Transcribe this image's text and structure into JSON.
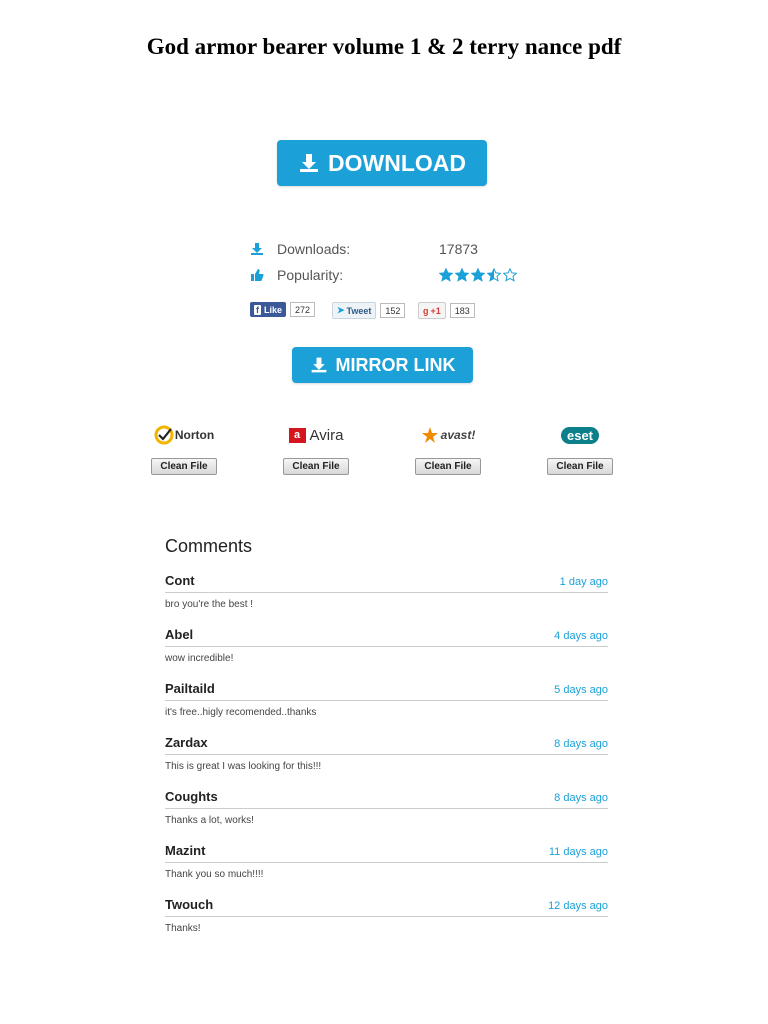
{
  "title": "God armor bearer volume 1 & 2 terry nance pdf",
  "download_button": {
    "label": "DOWNLOAD"
  },
  "stats": {
    "downloads_label": "Downloads:",
    "downloads_value": "17873",
    "popularity_label": "Popularity:",
    "popularity_stars": 3.5,
    "popularity_max": 5
  },
  "social": {
    "facebook": {
      "label": "Like",
      "count": "272"
    },
    "twitter": {
      "label": "Tweet",
      "count": "152"
    },
    "gplus": {
      "label": "+1",
      "count": "183"
    }
  },
  "mirror_button": {
    "label": "MIRROR LINK"
  },
  "antivirus": [
    {
      "name": "Norton",
      "badge": "Clean File"
    },
    {
      "name": "Avira",
      "badge": "Clean File"
    },
    {
      "name": "avast!",
      "badge": "Clean File"
    },
    {
      "name": "eset",
      "badge": "Clean File"
    }
  ],
  "comments": {
    "heading": "Comments",
    "items": [
      {
        "name": "Cont",
        "time": "1 day ago",
        "text": "bro you're the best !"
      },
      {
        "name": "Abel",
        "time": "4 days ago",
        "text": "wow incredible!"
      },
      {
        "name": "Pailtaild",
        "time": "5 days ago",
        "text": "it's free..higly recomended..thanks"
      },
      {
        "name": "Zardax",
        "time": "8 days ago",
        "text": "This is great I was looking for this!!!"
      },
      {
        "name": "Coughts",
        "time": "8 days ago",
        "text": "Thanks a lot, works!"
      },
      {
        "name": "Mazint",
        "time": "11 days ago",
        "text": "Thank you so much!!!!"
      },
      {
        "name": "Twouch",
        "time": "12 days ago",
        "text": "Thanks!"
      }
    ]
  },
  "colors": {
    "accent": "#1ba1d8",
    "facebook": "#3b5998",
    "star": "#1ba1d8"
  }
}
